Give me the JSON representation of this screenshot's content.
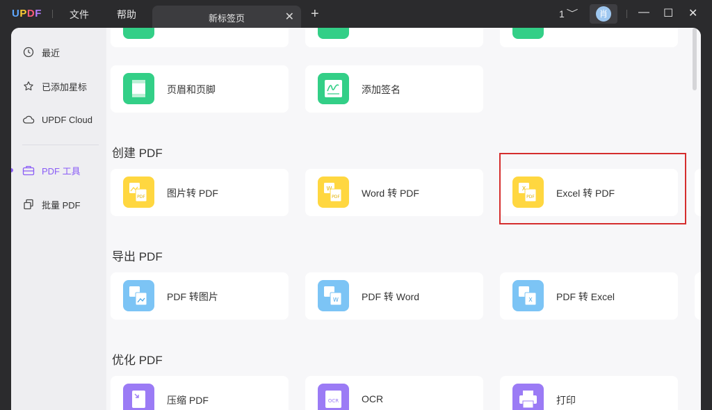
{
  "titlebar": {
    "logo": [
      "U",
      "P",
      "D",
      "F"
    ],
    "menu_file": "文件",
    "menu_help": "帮助",
    "tab_title": "新标签页",
    "tab_close": "✕",
    "new_tab": "+",
    "page_number": "1",
    "avatar_letter": "肖",
    "minimize": "—",
    "maximize": "☐",
    "close": "✕"
  },
  "sidebar": {
    "items": [
      {
        "label": "最近",
        "icon": "clock-icon"
      },
      {
        "label": "已添加星标",
        "icon": "star-icon"
      },
      {
        "label": "UPDF Cloud",
        "icon": "cloud-icon"
      },
      {
        "label": "PDF 工具",
        "icon": "toolbox-icon",
        "active": true
      },
      {
        "label": "批量 PDF",
        "icon": "batch-icon"
      }
    ]
  },
  "sections": {
    "top_cards": [
      "页眉和页脚",
      "添加签名"
    ],
    "create": {
      "title": "创建 PDF",
      "cards": [
        "图片转 PDF",
        "Word 转 PDF",
        "Excel 转 PDF"
      ]
    },
    "export": {
      "title": "导出 PDF",
      "cards": [
        "PDF 转图片",
        "PDF 转 Word",
        "PDF 转 Excel"
      ]
    },
    "optimize": {
      "title": "优化 PDF",
      "cards": [
        "压缩 PDF",
        "OCR",
        "打印"
      ]
    }
  },
  "colors": {
    "accent": "#8a5cf6",
    "highlight": "#d52d2d",
    "green": "#33cf87",
    "yellow": "#ffd740",
    "blue": "#7cc4f5",
    "purple": "#9b7bf5"
  }
}
